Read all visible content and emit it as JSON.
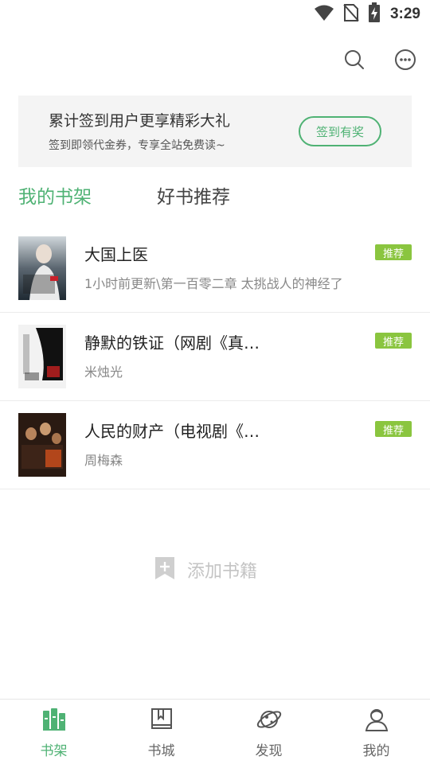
{
  "status_bar": {
    "time": "3:29"
  },
  "top_actions": {
    "search_icon": "search-icon",
    "more_icon": "more-icon"
  },
  "promo": {
    "title": "累计签到用户更享精彩大礼",
    "subtitle": "签到即领代金券，专享全站免费读~",
    "button": "签到有奖"
  },
  "tabs": [
    {
      "label": "我的书架",
      "active": true
    },
    {
      "label": "好书推荐",
      "active": false
    }
  ],
  "books": [
    {
      "title": "大国上医",
      "subtitle": "1小时前更新\\第一百零二章 太挑战人的神经了",
      "badge": "推荐"
    },
    {
      "title": "静默的铁证（网剧《真…",
      "subtitle": "米烛光",
      "badge": "推荐"
    },
    {
      "title": "人民的财产（电视剧《…",
      "subtitle": "周梅森",
      "badge": "推荐"
    }
  ],
  "add_book": {
    "label": "添加书籍"
  },
  "bottom_nav": [
    {
      "label": "书架",
      "icon": "bookshelf-icon",
      "active": true
    },
    {
      "label": "书城",
      "icon": "book-store-icon",
      "active": false
    },
    {
      "label": "发现",
      "icon": "planet-icon",
      "active": false
    },
    {
      "label": "我的",
      "icon": "user-icon",
      "active": false
    }
  ],
  "colors": {
    "accent": "#4fb274",
    "badge": "#8ac53f"
  }
}
